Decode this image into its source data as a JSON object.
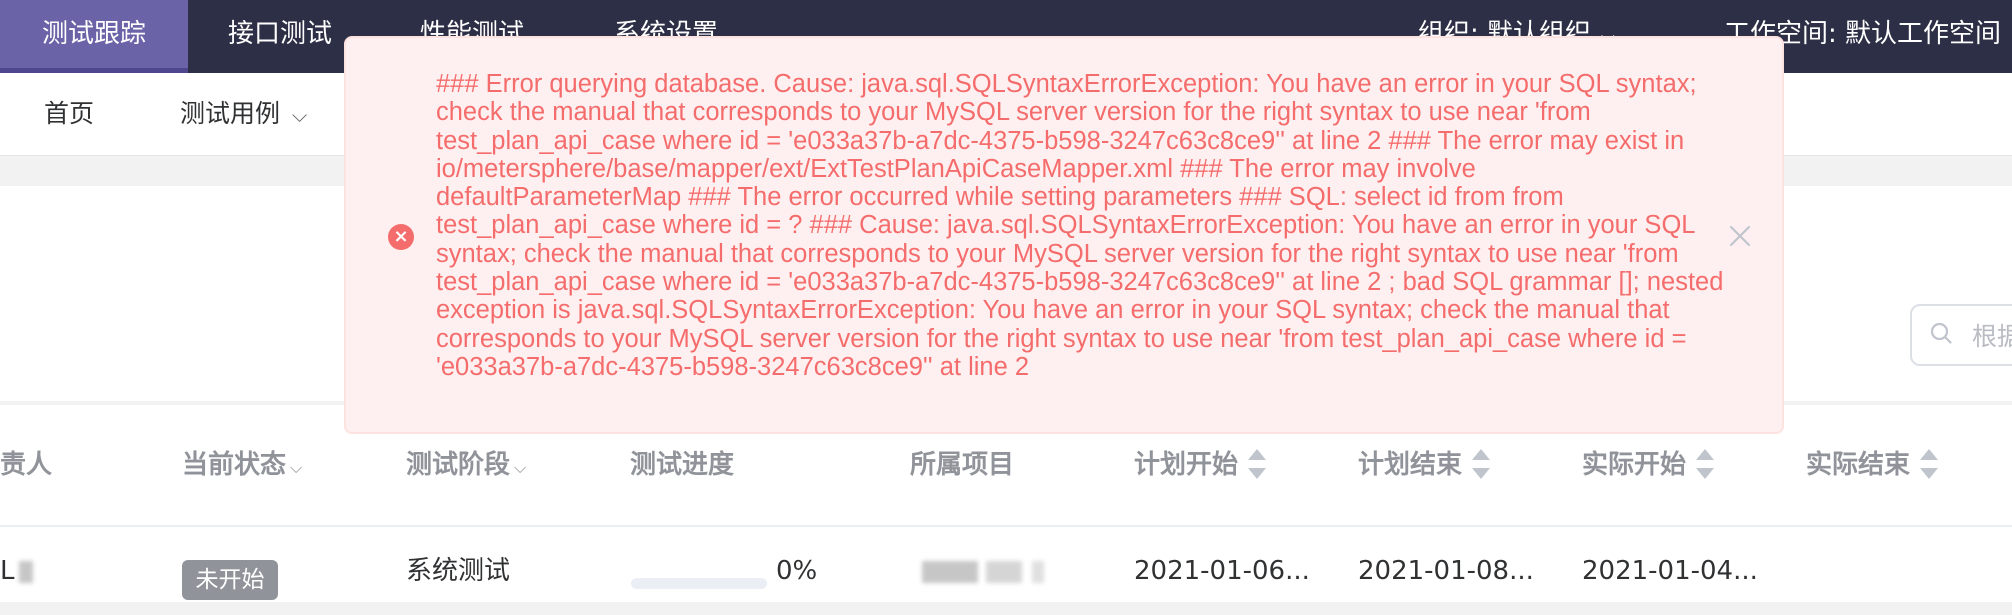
{
  "top_nav": {
    "items": [
      {
        "label": "测试跟踪",
        "active": true
      },
      {
        "label": "接口测试",
        "active": false
      },
      {
        "label": "性能测试",
        "active": false
      },
      {
        "label": "系统设置",
        "active": false
      }
    ],
    "organization": "组织: 默认组织",
    "workspace": "工作空间: 默认工作空间"
  },
  "sub_nav": {
    "items": [
      {
        "label": "首页"
      },
      {
        "label": "测试用例"
      }
    ]
  },
  "search": {
    "placeholder": "根据名称搜索"
  },
  "table": {
    "columns": [
      {
        "label": "责人",
        "filter": false,
        "sortable": false
      },
      {
        "label": "当前状态",
        "filter": true,
        "sortable": false
      },
      {
        "label": "测试阶段",
        "filter": true,
        "sortable": false
      },
      {
        "label": "测试进度",
        "filter": false,
        "sortable": false
      },
      {
        "label": "所属项目",
        "filter": false,
        "sortable": false
      },
      {
        "label": "计划开始",
        "filter": false,
        "sortable": true
      },
      {
        "label": "计划结束",
        "filter": false,
        "sortable": true
      },
      {
        "label": "实际开始",
        "filter": false,
        "sortable": true
      },
      {
        "label": "实际结束",
        "filter": false,
        "sortable": true
      }
    ],
    "rows": [
      {
        "owner": "L",
        "status": "未开始",
        "stage": "系统测试",
        "progress": "0%",
        "progress_value": 0,
        "plan_start": "2021-01-06...",
        "plan_end": "2021-01-08...",
        "actual_start": "2021-01-04..."
      }
    ]
  },
  "error_message": {
    "text": "### Error querying database. Cause: java.sql.SQLSyntaxErrorException: You have an error in your SQL syntax; check the manual that corresponds to your MySQL server version for the right syntax to use near 'from test_plan_api_case where id = 'e033a37b-a7dc-4375-b598-3247c63c8ce9'' at line 2 ### The error may exist in io/metersphere/base/mapper/ext/ExtTestPlanApiCaseMapper.xml ### The error may involve defaultParameterMap ### The error occurred while setting parameters ### SQL: select id from from test_plan_api_case where id = ? ### Cause: java.sql.SQLSyntaxErrorException: You have an error in your SQL syntax; check the manual that corresponds to your MySQL server version for the right syntax to use near 'from test_plan_api_case where id = 'e033a37b-a7dc-4375-b598-3247c63c8ce9'' at line 2 ; bad SQL grammar []; nested exception is java.sql.SQLSyntaxErrorException: You have an error in your SQL syntax; check the manual that corresponds to your MySQL server version for the right syntax to use near 'from test_plan_api_case where id = 'e033a37b-a7dc-4375-b598-3247c63c8ce9'' at line 2"
  },
  "colors": {
    "topbar": "#2c2f45",
    "active_tab": "#6b63a8",
    "error_text": "#f56c6c",
    "error_bg": "#fef0f0",
    "status_tag": "#909399"
  }
}
